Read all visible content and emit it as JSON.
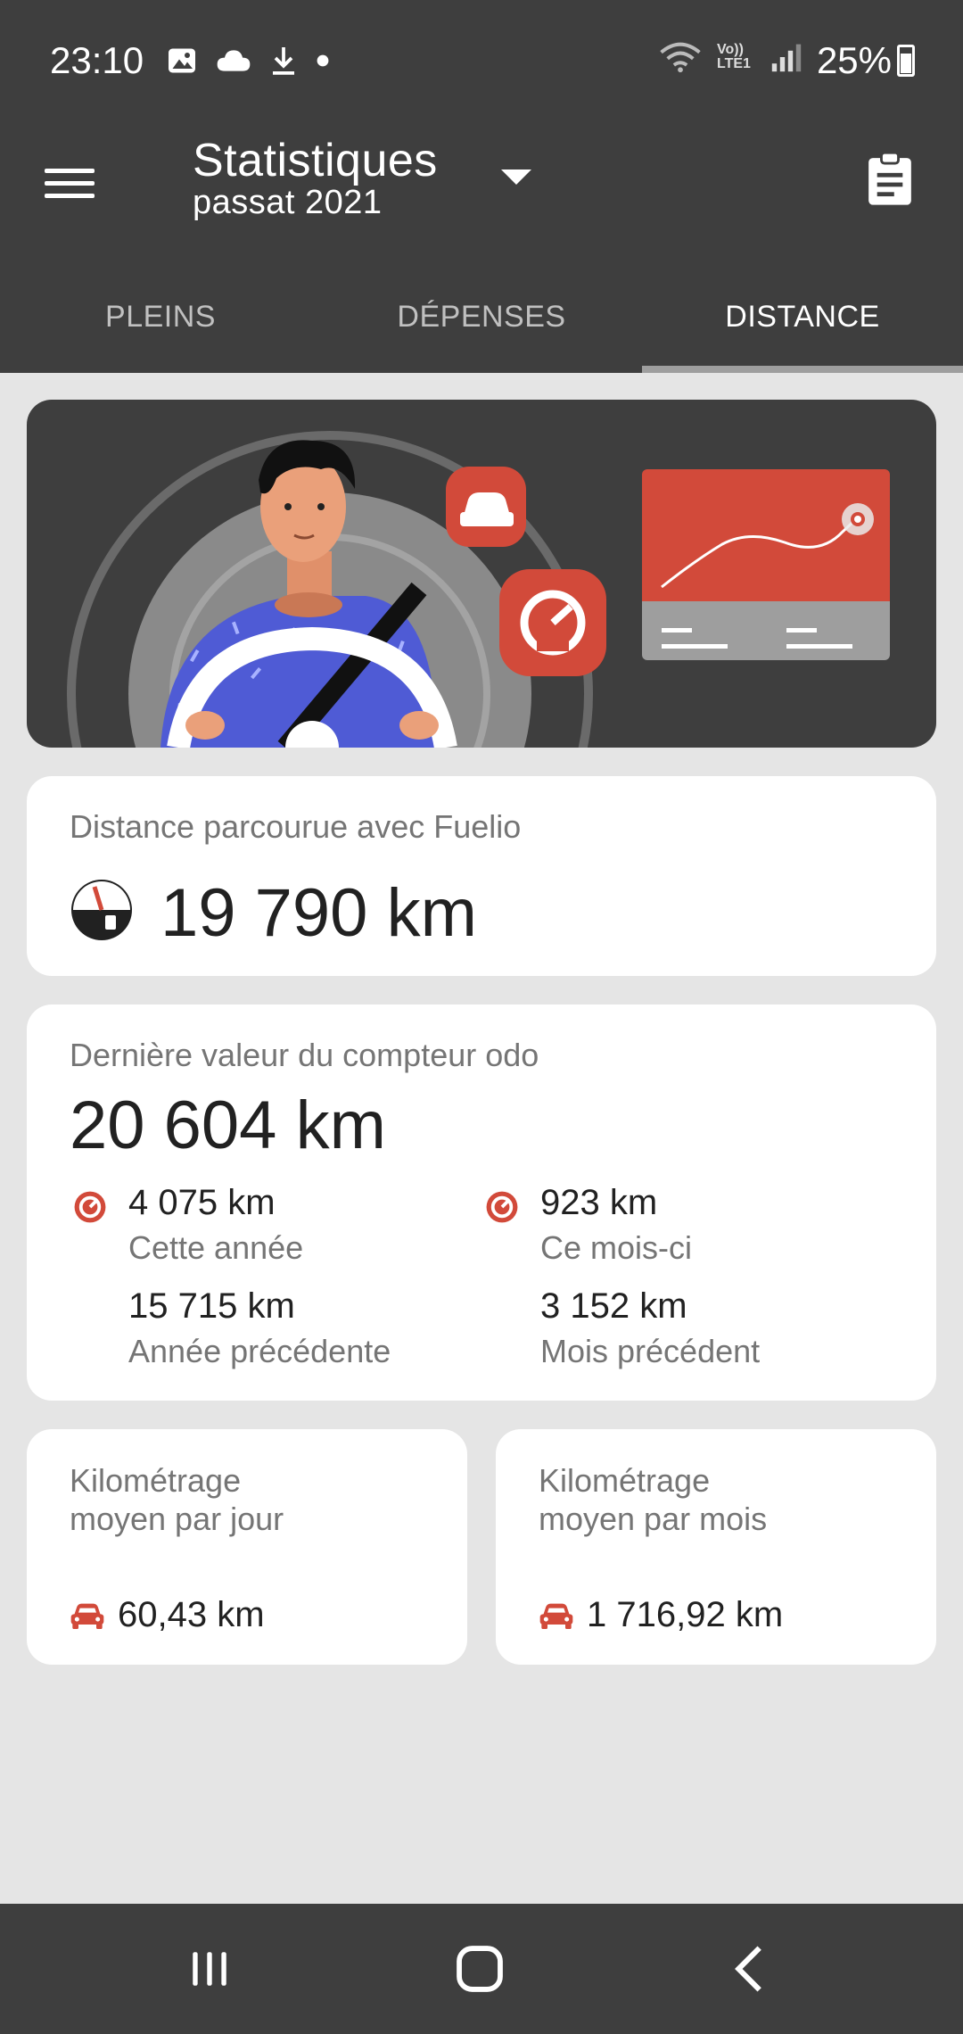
{
  "status_bar": {
    "time": "23:10",
    "battery": "25%",
    "icons_left": [
      "image-icon",
      "cloud-icon",
      "download-icon",
      "dot-icon"
    ],
    "icons_right": [
      "wifi-icon",
      "volte-icon",
      "signal-icon",
      "battery-icon"
    ],
    "volte_text": "Vo)) LTE1"
  },
  "app_bar": {
    "title": "Statistiques",
    "subtitle": "passat 2021",
    "menu_icon": "menu-icon",
    "action_icon": "clipboard-icon"
  },
  "tabs": [
    {
      "label": "PLEINS",
      "active": false
    },
    {
      "label": "DÉPENSES",
      "active": false
    },
    {
      "label": "DISTANCE",
      "active": true
    }
  ],
  "distance_card": {
    "label": "Distance parcourue avec Fuelio",
    "value": "19 790 km"
  },
  "odo_card": {
    "label": "Dernière valeur du compteur odo",
    "value": "20 604 km",
    "stats": [
      {
        "value": "4 075 km",
        "label": "Cette année",
        "prev_value": "15 715 km",
        "prev_label": "Année précédente"
      },
      {
        "value": "923 km",
        "label": "Ce mois-ci",
        "prev_value": "3 152 km",
        "prev_label": "Mois précédent"
      }
    ]
  },
  "avg_cards": [
    {
      "label": "Kilométrage moyen par jour",
      "value": "60,43 km"
    },
    {
      "label": "Kilométrage moyen par mois",
      "value": "1 716,92 km"
    }
  ],
  "colors": {
    "dark": "#3e3e3e",
    "accent_red": "#d24a3a",
    "background": "#e5e5e5"
  }
}
